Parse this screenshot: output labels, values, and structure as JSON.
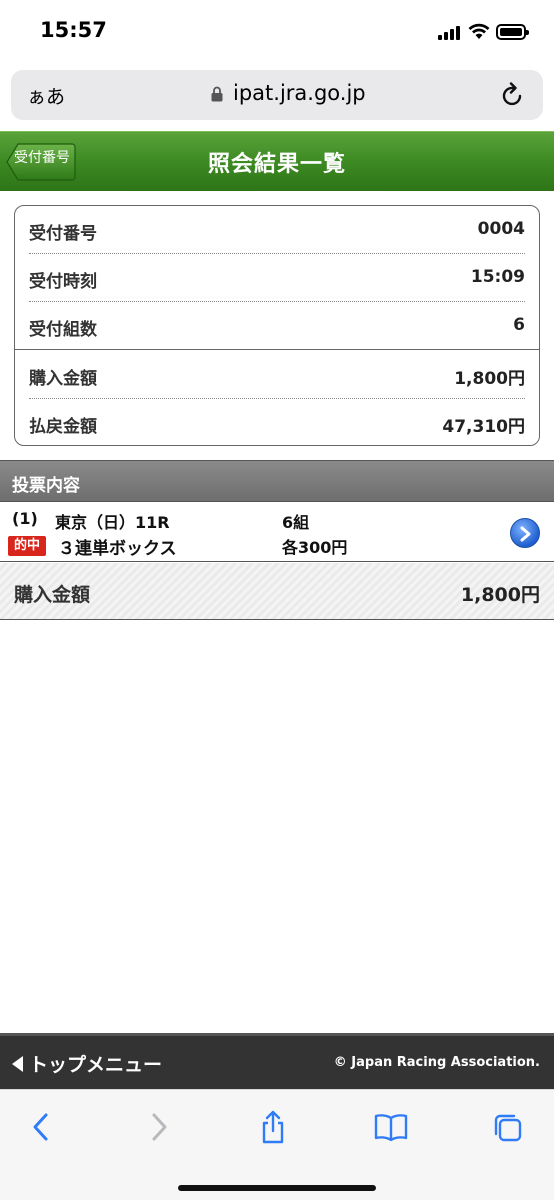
{
  "status_bar": {
    "time": "15:57"
  },
  "address_bar": {
    "aa_label": "ぁあ",
    "url": "ipat.jra.go.jp"
  },
  "header": {
    "back_label": "受付番号",
    "title": "照会結果一覧"
  },
  "summary": {
    "rows": [
      {
        "label": "受付番号",
        "value": "0004"
      },
      {
        "label": "受付時刻",
        "value": "15:09"
      },
      {
        "label": "受付組数",
        "value": "6"
      },
      {
        "label": "購入金額",
        "value": "1,800円"
      },
      {
        "label": "払戻金額",
        "value": "47,310円"
      }
    ]
  },
  "bet_section": {
    "title": "投票内容",
    "entries": [
      {
        "index": "(1)",
        "race": "東京（日）11R",
        "combos": "6組",
        "badge": "的中",
        "bet_type": "３連単ボックス",
        "amount_each": "各300円"
      }
    ],
    "total_label": "購入金額",
    "total_value": "1,800円"
  },
  "footer": {
    "top_menu_label": "トップメニュー",
    "copyright": "© Japan Racing Association."
  },
  "colors": {
    "header_green": "#3d8a23",
    "hit_badge_red": "#d9261c",
    "safari_blue": "#2f7cf6",
    "footer_dark": "#333333"
  },
  "icons": [
    "signal-icon",
    "wifi-icon",
    "battery-icon",
    "lock-icon",
    "reload-icon",
    "chevron-right-icon",
    "back-chevron-icon",
    "forward-chevron-icon",
    "share-icon",
    "bookmarks-icon",
    "tabs-icon"
  ]
}
